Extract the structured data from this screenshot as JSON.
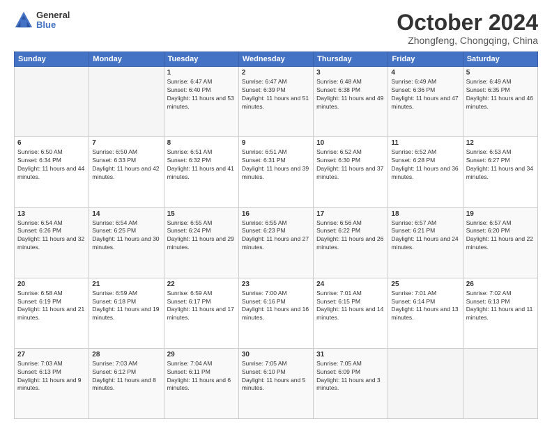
{
  "logo": {
    "general": "General",
    "blue": "Blue"
  },
  "header": {
    "title": "October 2024",
    "subtitle": "Zhongfeng, Chongqing, China"
  },
  "weekdays": [
    "Sunday",
    "Monday",
    "Tuesday",
    "Wednesday",
    "Thursday",
    "Friday",
    "Saturday"
  ],
  "weeks": [
    [
      {
        "day": "",
        "info": ""
      },
      {
        "day": "",
        "info": ""
      },
      {
        "day": "1",
        "info": "Sunrise: 6:47 AM\nSunset: 6:40 PM\nDaylight: 11 hours and 53 minutes."
      },
      {
        "day": "2",
        "info": "Sunrise: 6:47 AM\nSunset: 6:39 PM\nDaylight: 11 hours and 51 minutes."
      },
      {
        "day": "3",
        "info": "Sunrise: 6:48 AM\nSunset: 6:38 PM\nDaylight: 11 hours and 49 minutes."
      },
      {
        "day": "4",
        "info": "Sunrise: 6:49 AM\nSunset: 6:36 PM\nDaylight: 11 hours and 47 minutes."
      },
      {
        "day": "5",
        "info": "Sunrise: 6:49 AM\nSunset: 6:35 PM\nDaylight: 11 hours and 46 minutes."
      }
    ],
    [
      {
        "day": "6",
        "info": "Sunrise: 6:50 AM\nSunset: 6:34 PM\nDaylight: 11 hours and 44 minutes."
      },
      {
        "day": "7",
        "info": "Sunrise: 6:50 AM\nSunset: 6:33 PM\nDaylight: 11 hours and 42 minutes."
      },
      {
        "day": "8",
        "info": "Sunrise: 6:51 AM\nSunset: 6:32 PM\nDaylight: 11 hours and 41 minutes."
      },
      {
        "day": "9",
        "info": "Sunrise: 6:51 AM\nSunset: 6:31 PM\nDaylight: 11 hours and 39 minutes."
      },
      {
        "day": "10",
        "info": "Sunrise: 6:52 AM\nSunset: 6:30 PM\nDaylight: 11 hours and 37 minutes."
      },
      {
        "day": "11",
        "info": "Sunrise: 6:52 AM\nSunset: 6:28 PM\nDaylight: 11 hours and 36 minutes."
      },
      {
        "day": "12",
        "info": "Sunrise: 6:53 AM\nSunset: 6:27 PM\nDaylight: 11 hours and 34 minutes."
      }
    ],
    [
      {
        "day": "13",
        "info": "Sunrise: 6:54 AM\nSunset: 6:26 PM\nDaylight: 11 hours and 32 minutes."
      },
      {
        "day": "14",
        "info": "Sunrise: 6:54 AM\nSunset: 6:25 PM\nDaylight: 11 hours and 30 minutes."
      },
      {
        "day": "15",
        "info": "Sunrise: 6:55 AM\nSunset: 6:24 PM\nDaylight: 11 hours and 29 minutes."
      },
      {
        "day": "16",
        "info": "Sunrise: 6:55 AM\nSunset: 6:23 PM\nDaylight: 11 hours and 27 minutes."
      },
      {
        "day": "17",
        "info": "Sunrise: 6:56 AM\nSunset: 6:22 PM\nDaylight: 11 hours and 26 minutes."
      },
      {
        "day": "18",
        "info": "Sunrise: 6:57 AM\nSunset: 6:21 PM\nDaylight: 11 hours and 24 minutes."
      },
      {
        "day": "19",
        "info": "Sunrise: 6:57 AM\nSunset: 6:20 PM\nDaylight: 11 hours and 22 minutes."
      }
    ],
    [
      {
        "day": "20",
        "info": "Sunrise: 6:58 AM\nSunset: 6:19 PM\nDaylight: 11 hours and 21 minutes."
      },
      {
        "day": "21",
        "info": "Sunrise: 6:59 AM\nSunset: 6:18 PM\nDaylight: 11 hours and 19 minutes."
      },
      {
        "day": "22",
        "info": "Sunrise: 6:59 AM\nSunset: 6:17 PM\nDaylight: 11 hours and 17 minutes."
      },
      {
        "day": "23",
        "info": "Sunrise: 7:00 AM\nSunset: 6:16 PM\nDaylight: 11 hours and 16 minutes."
      },
      {
        "day": "24",
        "info": "Sunrise: 7:01 AM\nSunset: 6:15 PM\nDaylight: 11 hours and 14 minutes."
      },
      {
        "day": "25",
        "info": "Sunrise: 7:01 AM\nSunset: 6:14 PM\nDaylight: 11 hours and 13 minutes."
      },
      {
        "day": "26",
        "info": "Sunrise: 7:02 AM\nSunset: 6:13 PM\nDaylight: 11 hours and 11 minutes."
      }
    ],
    [
      {
        "day": "27",
        "info": "Sunrise: 7:03 AM\nSunset: 6:13 PM\nDaylight: 11 hours and 9 minutes."
      },
      {
        "day": "28",
        "info": "Sunrise: 7:03 AM\nSunset: 6:12 PM\nDaylight: 11 hours and 8 minutes."
      },
      {
        "day": "29",
        "info": "Sunrise: 7:04 AM\nSunset: 6:11 PM\nDaylight: 11 hours and 6 minutes."
      },
      {
        "day": "30",
        "info": "Sunrise: 7:05 AM\nSunset: 6:10 PM\nDaylight: 11 hours and 5 minutes."
      },
      {
        "day": "31",
        "info": "Sunrise: 7:05 AM\nSunset: 6:09 PM\nDaylight: 11 hours and 3 minutes."
      },
      {
        "day": "",
        "info": ""
      },
      {
        "day": "",
        "info": ""
      }
    ]
  ]
}
